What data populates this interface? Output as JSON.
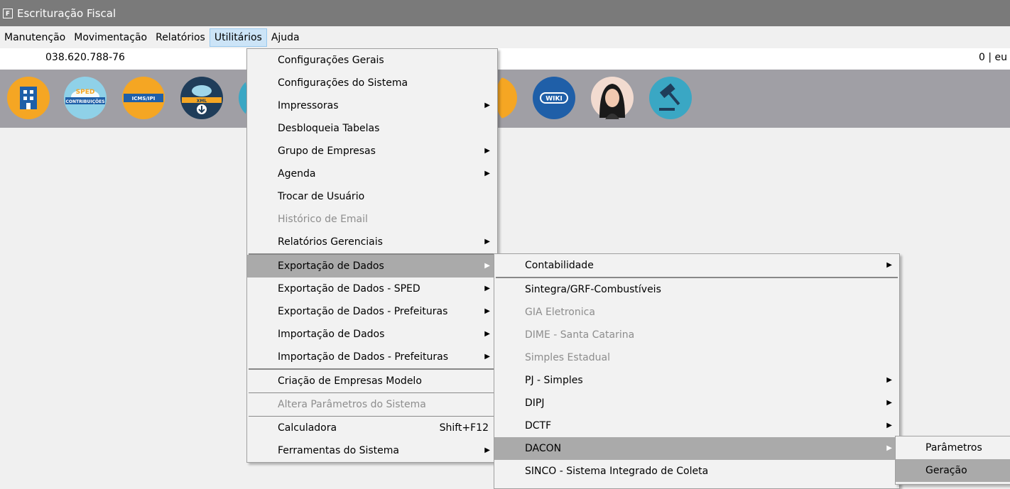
{
  "window": {
    "title": "Escrituração Fiscal",
    "icon": "app-logo-icon"
  },
  "menubar": {
    "items": [
      "Manutenção",
      "Movimentação",
      "Relatórios",
      "Utilitários",
      "Ajuda"
    ],
    "open": "Utilitários"
  },
  "infobar": {
    "cpf": "038.620.788-76",
    "right_text": "0 | eu"
  },
  "toolbar": {
    "buttons": [
      "company-icon",
      "sped-contribuicoes-icon",
      "icms-ipi-icon",
      "xml-download-icon",
      "unknown-icon",
      "chat-icon",
      "wiki-icon",
      "assistant-avatar-icon",
      "gavel-icon"
    ],
    "labels": {
      "sped_top": "SPED",
      "sped_bottom": "CONTRIBUIÇÕES",
      "icms": "ICMS/IPI",
      "xml": "XML",
      "wiki": "WIKI"
    }
  },
  "utilitarios_menu": {
    "items": [
      {
        "label": "Configurações Gerais"
      },
      {
        "label": "Configurações do Sistema"
      },
      {
        "label": "Impressoras",
        "submenu": true
      },
      {
        "label": "Desbloqueia Tabelas"
      },
      {
        "label": "Grupo de Empresas",
        "submenu": true
      },
      {
        "label": "Agenda",
        "submenu": true
      },
      {
        "label": "Trocar de Usuário"
      },
      {
        "label": "Histórico de Email",
        "disabled": true
      },
      {
        "label": "Relatórios Gerenciais",
        "submenu": true
      },
      {
        "label": "Exportação de Dados",
        "submenu": true,
        "highlighted": true
      },
      {
        "label": "Exportação de Dados - SPED",
        "submenu": true
      },
      {
        "label": "Exportação de Dados - Prefeituras",
        "submenu": true
      },
      {
        "label": "Importação de Dados",
        "submenu": true
      },
      {
        "label": "Importação de Dados - Prefeituras",
        "submenu": true
      },
      {
        "label": "Criação de Empresas Modelo"
      },
      {
        "label": "Altera Parâmetros do Sistema",
        "disabled": true
      },
      {
        "label": "Calculadora",
        "shortcut": "Shift+F12"
      },
      {
        "label": "Ferramentas do Sistema",
        "submenu": true
      }
    ]
  },
  "exportacao_menu": {
    "items": [
      {
        "label": "Contabilidade",
        "submenu": true
      },
      {
        "label": "Sintegra/GRF-Combustíveis"
      },
      {
        "label": "GIA Eletronica",
        "disabled": true
      },
      {
        "label": "DIME - Santa Catarina",
        "disabled": true
      },
      {
        "label": "Simples Estadual",
        "disabled": true
      },
      {
        "label": "PJ - Simples",
        "submenu": true
      },
      {
        "label": "DIPJ",
        "submenu": true
      },
      {
        "label": "DCTF",
        "submenu": true
      },
      {
        "label": "DACON",
        "submenu": true,
        "highlighted": true
      },
      {
        "label": "SINCO - Sistema Integrado de Coleta"
      }
    ]
  },
  "dacon_menu": {
    "items": [
      {
        "label": "Parâmetros"
      },
      {
        "label": "Geração",
        "highlighted": true
      }
    ]
  }
}
